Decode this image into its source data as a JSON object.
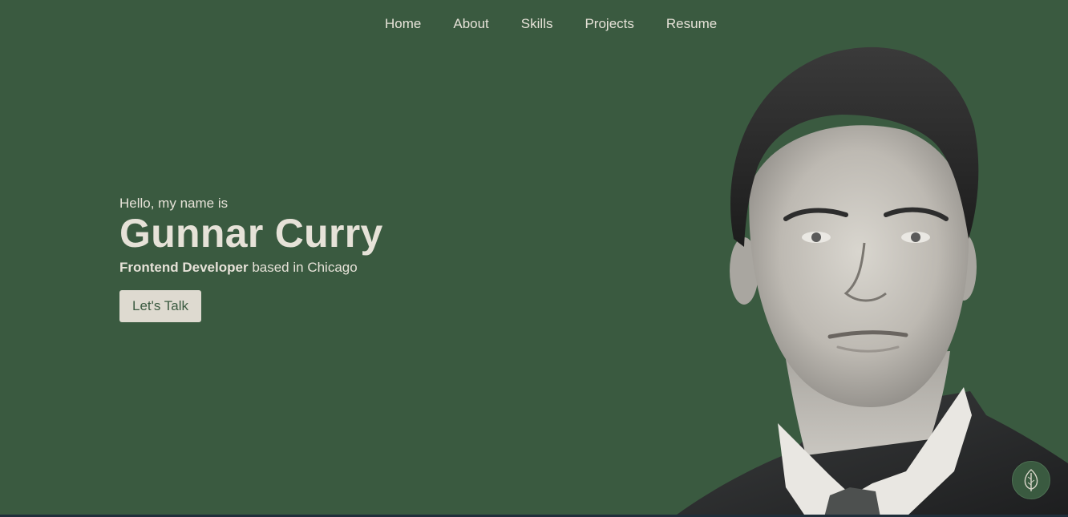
{
  "nav": {
    "items": [
      {
        "label": "Home"
      },
      {
        "label": "About"
      },
      {
        "label": "Skills"
      },
      {
        "label": "Projects"
      },
      {
        "label": "Resume"
      }
    ]
  },
  "hero": {
    "greeting": "Hello, my name is",
    "name": "Gunnar Curry",
    "role": "Frontend Developer",
    "location_text": " based in Chicago",
    "cta_label": "Let's Talk"
  },
  "portrait": {
    "subject": "grayscale-portrait-of-man-in-suit"
  },
  "fab": {
    "icon": "leaf-icon"
  },
  "colors": {
    "background": "#3a5a40",
    "text": "#e6e2d8",
    "button_bg": "#dedad0",
    "button_text": "#3a5a40"
  }
}
